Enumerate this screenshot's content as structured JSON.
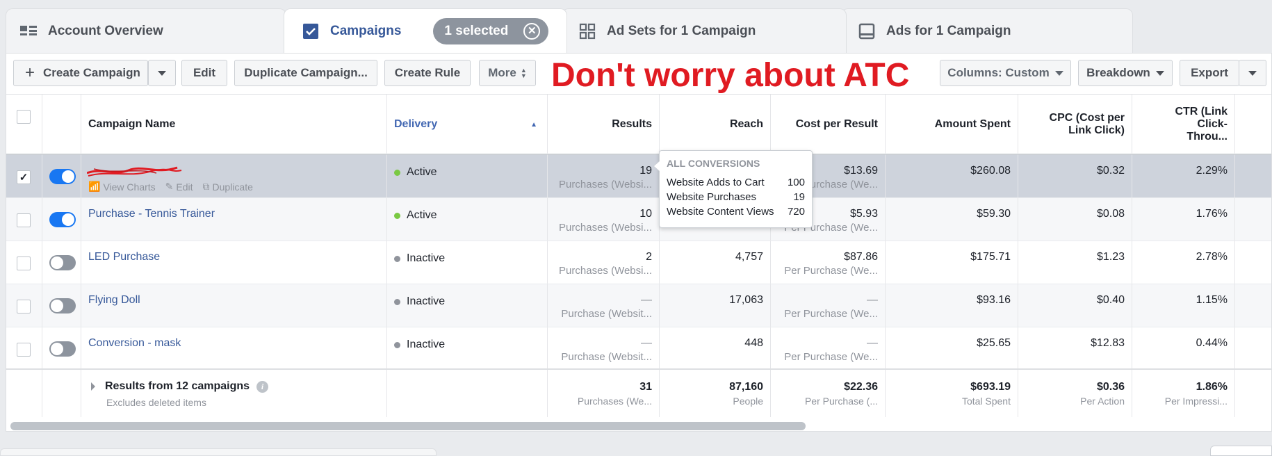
{
  "tabs": {
    "account_overview": "Account Overview",
    "campaigns": "Campaigns",
    "selected_pill": "1 selected",
    "ad_sets": "Ad Sets for 1 Campaign",
    "ads": "Ads for 1 Campaign"
  },
  "toolbar": {
    "create_label": "Create Campaign",
    "edit_label": "Edit",
    "duplicate_label": "Duplicate Campaign...",
    "create_rule_label": "Create Rule",
    "more_label": "More",
    "columns_label": "Columns: Custom",
    "breakdown_label": "Breakdown",
    "export_label": "Export"
  },
  "annotation": "Don't worry about ATC",
  "headers": {
    "campaign_name": "Campaign Name",
    "delivery": "Delivery",
    "results": "Results",
    "reach": "Reach",
    "cost_per_result": "Cost per Result",
    "amount_spent": "Amount Spent",
    "cpc": "CPC (Cost per Link Click)",
    "ctr": "CTR (Link Click-Throu..."
  },
  "row_actions": {
    "view_charts": "View Charts",
    "edit": "Edit",
    "duplicate": "Duplicate"
  },
  "rows": [
    {
      "name": "",
      "delivery": "Active",
      "results": "19",
      "results_sub": "Purchases (Websi...",
      "reach": "",
      "cost": "$13.69",
      "cost_sub": "Per Purchase (We...",
      "spent": "$260.08",
      "cpc": "$0.32",
      "ctr": "2.29%"
    },
    {
      "name": "Purchase - Tennis Trainer",
      "delivery": "Active",
      "results": "10",
      "results_sub": "Purchases (Websi...",
      "reach": "",
      "cost": "$5.93",
      "cost_sub": "Per Purchase (We...",
      "spent": "$59.30",
      "cpc": "$0.08",
      "ctr": "1.76%"
    },
    {
      "name": "LED Purchase",
      "delivery": "Inactive",
      "results": "2",
      "results_sub": "Purchases (Websi...",
      "reach": "4,757",
      "cost": "$87.86",
      "cost_sub": "Per Purchase (We...",
      "spent": "$175.71",
      "cpc": "$1.23",
      "ctr": "2.78%"
    },
    {
      "name": "Flying Doll",
      "delivery": "Inactive",
      "results": "—",
      "results_sub": "Purchase (Websit...",
      "reach": "17,063",
      "cost": "—",
      "cost_sub": "Per Purchase (We...",
      "spent": "$93.16",
      "cpc": "$0.40",
      "ctr": "1.15%"
    },
    {
      "name": "Conversion - mask",
      "delivery": "Inactive",
      "results": "—",
      "results_sub": "Purchase (Websit...",
      "reach": "448",
      "cost": "—",
      "cost_sub": "Per Purchase (We...",
      "spent": "$25.65",
      "cpc": "$12.83",
      "ctr": "0.44%"
    }
  ],
  "totals": {
    "label": "Results from 12 campaigns",
    "sub": "Excludes deleted items",
    "results": "31",
    "results_sub": "Purchases (We...",
    "reach": "87,160",
    "reach_sub": "People",
    "cost": "$22.36",
    "cost_sub": "Per Purchase (...",
    "spent": "$693.19",
    "spent_sub": "Total Spent",
    "cpc": "$0.36",
    "cpc_sub": "Per Action",
    "ctr": "1.86%",
    "ctr_sub": "Per Impressi..."
  },
  "tooltip": {
    "title": "ALL CONVERSIONS",
    "items": [
      {
        "label": "Website Adds to Cart",
        "value": "100"
      },
      {
        "label": "Website Purchases",
        "value": "19"
      },
      {
        "label": "Website Content Views",
        "value": "720"
      }
    ]
  },
  "colors": {
    "accent": "#365899",
    "toggle_on": "#1877f2",
    "active_dot": "#7ac943",
    "inactive_dot": "#90949c",
    "annotation": "#e01b22",
    "selected_row": "#ced3dc"
  }
}
